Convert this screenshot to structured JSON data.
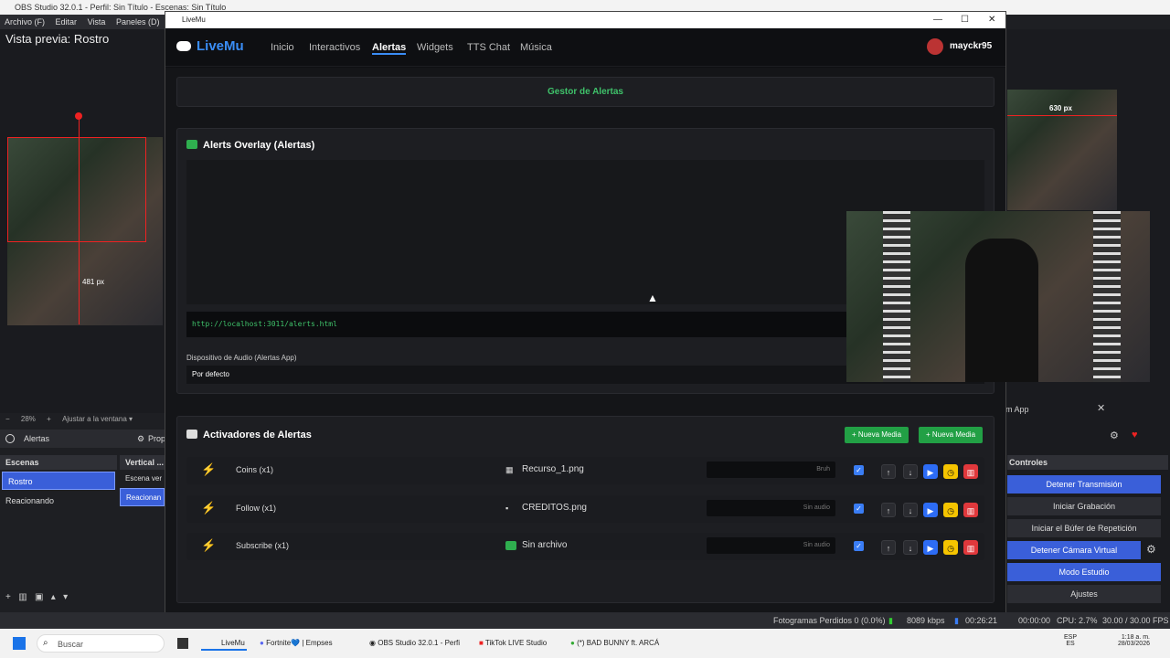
{
  "obs": {
    "title": "OBS Studio 32.0.1 - Perfil: Sin Título - Escenas: Sin Título",
    "menu": [
      "Archivo (F)",
      "Editar",
      "Vista",
      "Paneles (D)"
    ],
    "preview_label": "Vista previa: Rostro",
    "size_label_left": "481 px",
    "size_label_right": "630 px",
    "zoom": "28%",
    "fit_label": "Ajustar a la ventana",
    "source_name": "Alertas",
    "props_label": "Prop",
    "scenes_header": "Escenas",
    "vertical_header": "Vertical ...",
    "scenes": [
      "Rostro",
      "Reacionando"
    ],
    "vertical_scenes": [
      "Escena ver",
      "Reacionan"
    ],
    "app_label": "m App",
    "controls_header": "Controles",
    "controls": [
      "Detener Transmisión",
      "Iniciar Grabación",
      "Iniciar el Búfer de Repetición",
      "Detener Cámara Virtual",
      "Modo Estudio",
      "Ajustes"
    ],
    "status": {
      "dropped": "Fotogramas Perdidos 0 (0.0%)",
      "bitrate": "8089 kbps",
      "stream_time": "00:26:21",
      "rec_time": "00:00:00",
      "cpu": "CPU: 2.7%",
      "fps": "30.00 / 30.00 FPS"
    }
  },
  "taskbar": {
    "search_placeholder": "Buscar",
    "items": [
      "LiveMu",
      "Fortnite💙 | Empses",
      "OBS Studio 32.0.1 - Perfi",
      "TikTok LIVE Studio",
      "(*) BAD BUNNY ft. ARCÁ"
    ],
    "lang": "ESP",
    "region": "ES",
    "time": "1:18 a. m.",
    "date": "28/03/2026"
  },
  "livemu": {
    "window_title": "LiveMu",
    "brand": "LiveMu",
    "nav": [
      "Inicio",
      "Interactivos",
      "Alertas",
      "Widgets",
      "TTS Chat",
      "Música"
    ],
    "active_nav": "Alertas",
    "username": "mayckr95",
    "manager_title": "Gestor de Alertas",
    "overlay_title": "Alerts Overlay (Alertas)",
    "overlay_url": "http://localhost:3011/alerts.html",
    "audio_device_label": "Dispositivo de Audio (Alertas App)",
    "audio_device_value": "Por defecto",
    "triggers_title": "Activadores de Alertas",
    "new_media_1": "+ Nueva Media",
    "new_media_2": "+ Nueva Media",
    "triggers": [
      {
        "label": "Coins (x1)",
        "file": "Recurso_1.png",
        "audio": "Bruh",
        "checked": true
      },
      {
        "label": "Follow (x1)",
        "file": "CREDITOS.png",
        "audio": "Sin audio",
        "checked": true
      },
      {
        "label": "Subscribe (x1)",
        "file": "Sin archivo",
        "audio": "Sin audio",
        "checked": true
      }
    ],
    "colors": {
      "accent": "#2d6cf5",
      "green": "#2fae4f",
      "yellow": "#f5c400",
      "red": "#e0383c"
    }
  }
}
